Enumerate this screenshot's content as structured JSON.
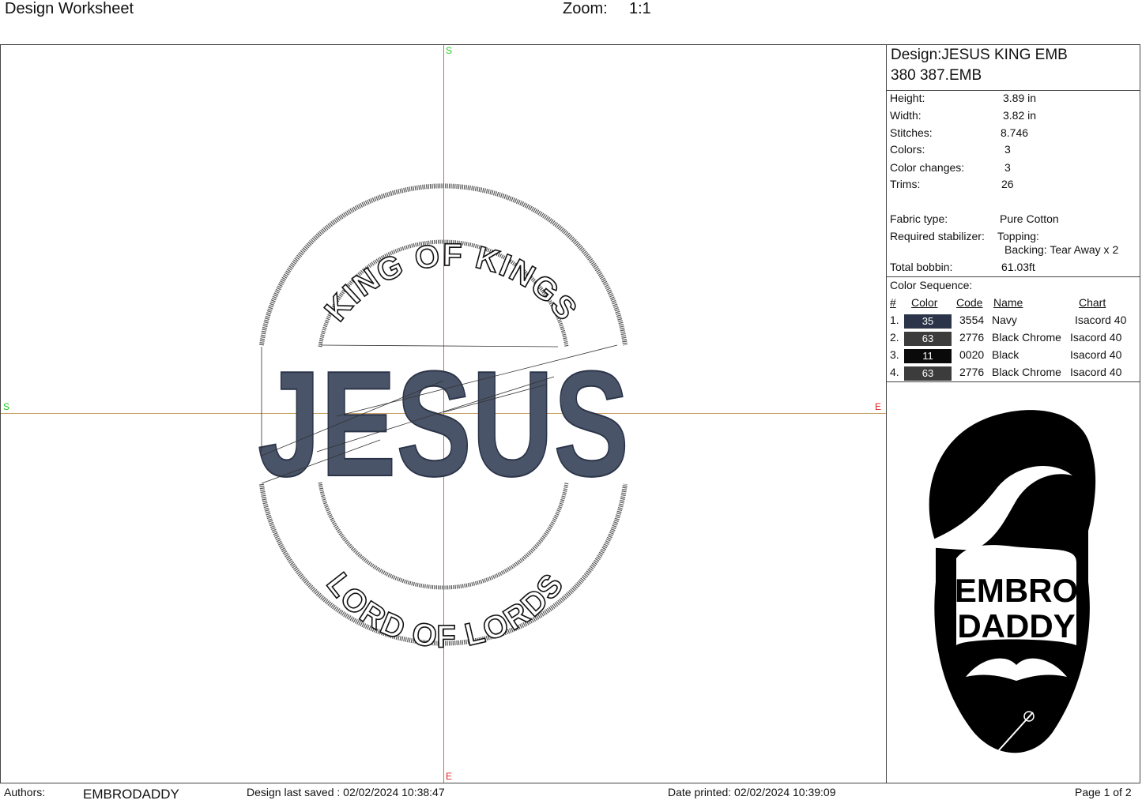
{
  "header": {
    "title": "Design Worksheet",
    "zoom_label": "Zoom:",
    "zoom_value": "1:1"
  },
  "canvas": {
    "axis_markers": {
      "top": "S",
      "left": "S",
      "right": "E",
      "bottom": "E"
    },
    "design_text": {
      "top_arc": "KING OF KINGS",
      "main": "JESUS",
      "bottom_arc": "LORD OF LORDS"
    }
  },
  "panel": {
    "design_name_line1": "Design:JESUS KING EMB",
    "design_name_line2": "380 387.EMB",
    "stats": [
      {
        "label": "Height:",
        "value": "3.89 in"
      },
      {
        "label": "Width:",
        "value": "3.82 in"
      },
      {
        "label": "Stitches:",
        "value": "8.746"
      },
      {
        "label": "Colors:",
        "value": "3"
      },
      {
        "label": "Color changes:",
        "value": "3"
      },
      {
        "label": "Trims:",
        "value": "26"
      }
    ],
    "fabric_label": "Fabric type:",
    "fabric_value": "Pure Cotton",
    "stabilizer_label": "Required stabilizer:",
    "topping_label": "Topping:",
    "backing_label": "Backing: Tear Away x 2",
    "bobbin_label": "Total bobbin:",
    "bobbin_value": "61.03ft",
    "color_sequence_title": "Color Sequence:",
    "color_headers": {
      "num": "#",
      "color": "Color",
      "code": "Code",
      "name": "Name",
      "chart": "Chart"
    },
    "colors": [
      {
        "num": "1.",
        "swatch": "35",
        "hex": "#2b3448",
        "code": "3554",
        "name": "Navy",
        "chart": "Isacord 40"
      },
      {
        "num": "2.",
        "swatch": "63",
        "hex": "#3c3c3c",
        "code": "2776",
        "name": "Black Chrome",
        "chart": "Isacord 40"
      },
      {
        "num": "3.",
        "swatch": "11",
        "hex": "#0a0a0a",
        "code": "0020",
        "name": "Black",
        "chart": "Isacord 40"
      },
      {
        "num": "4.",
        "swatch": "63",
        "hex": "#3c3c3c",
        "code": "2776",
        "name": "Black Chrome",
        "chart": "Isacord 40"
      }
    ],
    "logo": {
      "line1": "EMBRO",
      "line2": "DADDY"
    }
  },
  "footer": {
    "authors_label": "Authors:",
    "authors_value": "EMBRODADDY",
    "saved": "Design last saved : 02/02/2024 10:38:47",
    "printed": "Date printed: 02/02/2024 10:39:09",
    "page": "Page 1 of 2"
  }
}
